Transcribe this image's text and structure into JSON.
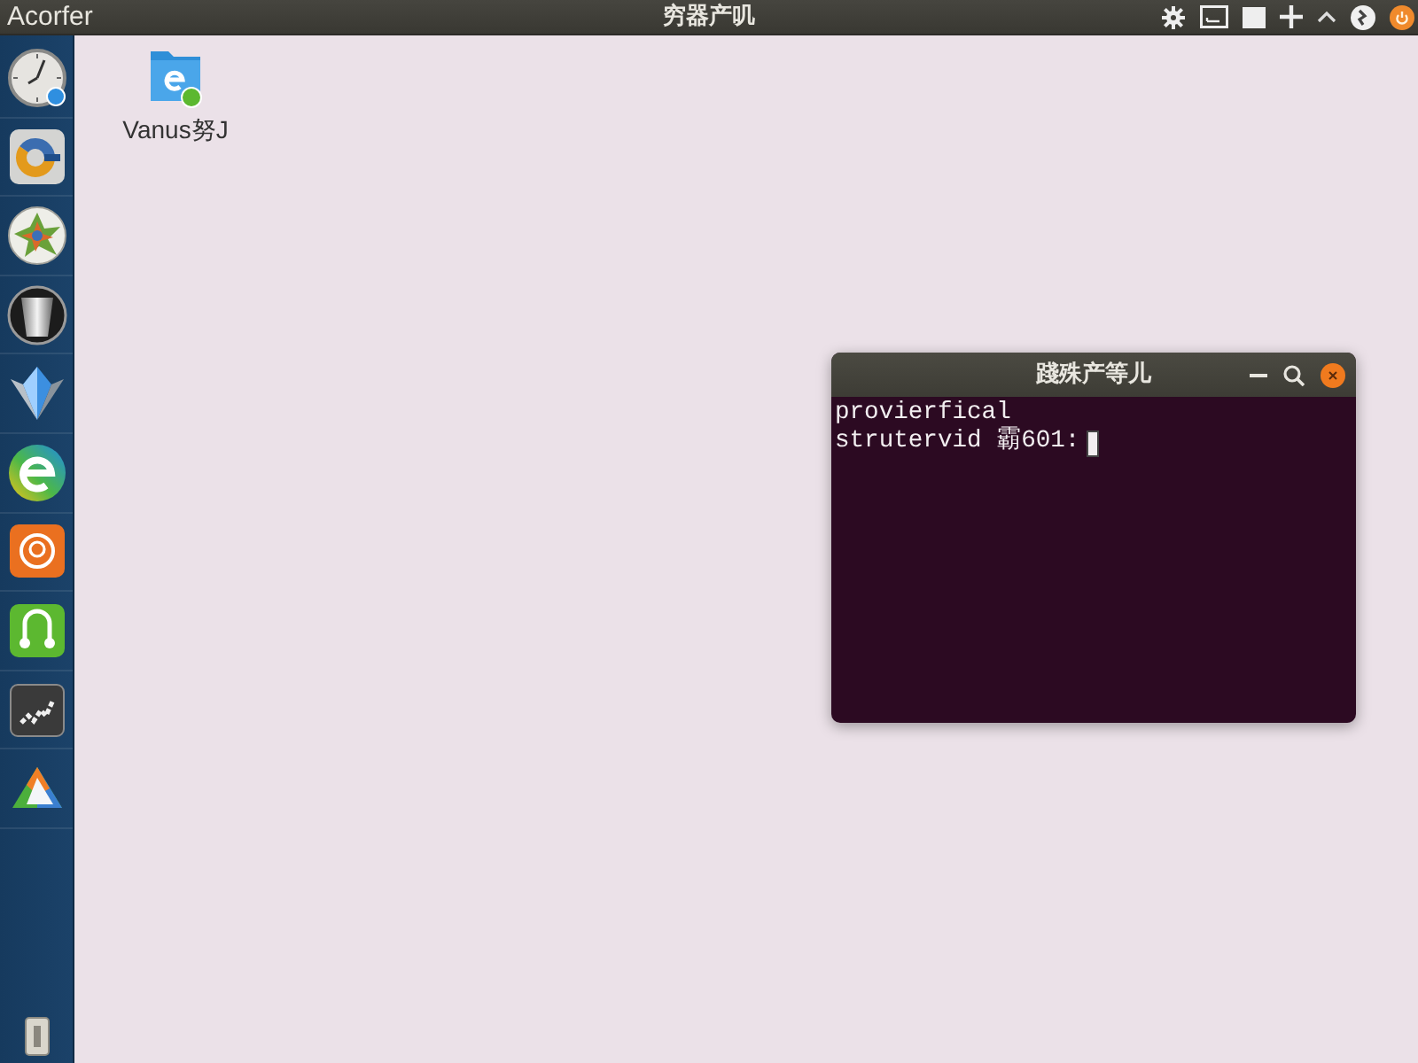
{
  "top_bar": {
    "title": "Acorfer",
    "center_text": "穷器产叽"
  },
  "desktop_icons": [
    {
      "label": "Vanus努J"
    }
  ],
  "terminal": {
    "title": "踐殊产等儿",
    "lines": [
      "provierfical",
      "strutervid 霸601:"
    ]
  }
}
